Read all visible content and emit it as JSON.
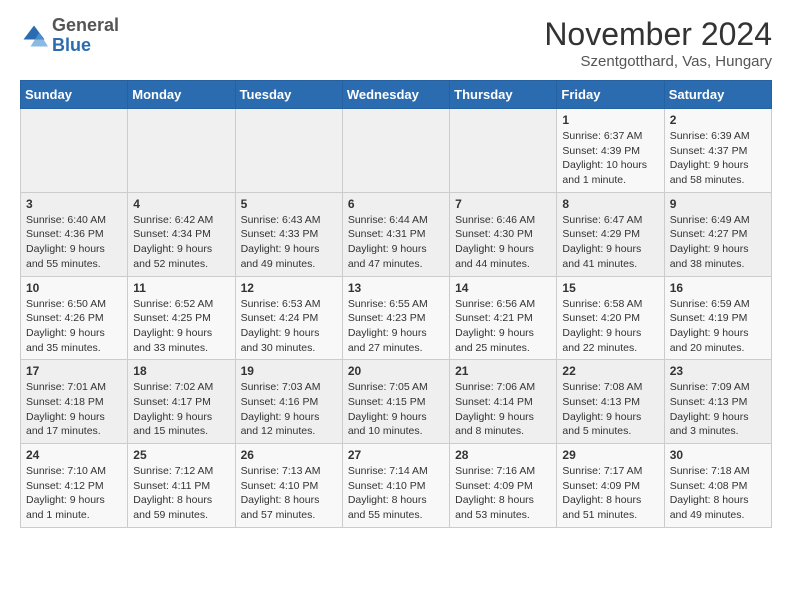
{
  "header": {
    "logo_general": "General",
    "logo_blue": "Blue",
    "title": "November 2024",
    "subtitle": "Szentgotthard, Vas, Hungary"
  },
  "days_of_week": [
    "Sunday",
    "Monday",
    "Tuesday",
    "Wednesday",
    "Thursday",
    "Friday",
    "Saturday"
  ],
  "weeks": [
    [
      {
        "day": "",
        "info": ""
      },
      {
        "day": "",
        "info": ""
      },
      {
        "day": "",
        "info": ""
      },
      {
        "day": "",
        "info": ""
      },
      {
        "day": "",
        "info": ""
      },
      {
        "day": "1",
        "info": "Sunrise: 6:37 AM\nSunset: 4:39 PM\nDaylight: 10 hours and 1 minute."
      },
      {
        "day": "2",
        "info": "Sunrise: 6:39 AM\nSunset: 4:37 PM\nDaylight: 9 hours and 58 minutes."
      }
    ],
    [
      {
        "day": "3",
        "info": "Sunrise: 6:40 AM\nSunset: 4:36 PM\nDaylight: 9 hours and 55 minutes."
      },
      {
        "day": "4",
        "info": "Sunrise: 6:42 AM\nSunset: 4:34 PM\nDaylight: 9 hours and 52 minutes."
      },
      {
        "day": "5",
        "info": "Sunrise: 6:43 AM\nSunset: 4:33 PM\nDaylight: 9 hours and 49 minutes."
      },
      {
        "day": "6",
        "info": "Sunrise: 6:44 AM\nSunset: 4:31 PM\nDaylight: 9 hours and 47 minutes."
      },
      {
        "day": "7",
        "info": "Sunrise: 6:46 AM\nSunset: 4:30 PM\nDaylight: 9 hours and 44 minutes."
      },
      {
        "day": "8",
        "info": "Sunrise: 6:47 AM\nSunset: 4:29 PM\nDaylight: 9 hours and 41 minutes."
      },
      {
        "day": "9",
        "info": "Sunrise: 6:49 AM\nSunset: 4:27 PM\nDaylight: 9 hours and 38 minutes."
      }
    ],
    [
      {
        "day": "10",
        "info": "Sunrise: 6:50 AM\nSunset: 4:26 PM\nDaylight: 9 hours and 35 minutes."
      },
      {
        "day": "11",
        "info": "Sunrise: 6:52 AM\nSunset: 4:25 PM\nDaylight: 9 hours and 33 minutes."
      },
      {
        "day": "12",
        "info": "Sunrise: 6:53 AM\nSunset: 4:24 PM\nDaylight: 9 hours and 30 minutes."
      },
      {
        "day": "13",
        "info": "Sunrise: 6:55 AM\nSunset: 4:23 PM\nDaylight: 9 hours and 27 minutes."
      },
      {
        "day": "14",
        "info": "Sunrise: 6:56 AM\nSunset: 4:21 PM\nDaylight: 9 hours and 25 minutes."
      },
      {
        "day": "15",
        "info": "Sunrise: 6:58 AM\nSunset: 4:20 PM\nDaylight: 9 hours and 22 minutes."
      },
      {
        "day": "16",
        "info": "Sunrise: 6:59 AM\nSunset: 4:19 PM\nDaylight: 9 hours and 20 minutes."
      }
    ],
    [
      {
        "day": "17",
        "info": "Sunrise: 7:01 AM\nSunset: 4:18 PM\nDaylight: 9 hours and 17 minutes."
      },
      {
        "day": "18",
        "info": "Sunrise: 7:02 AM\nSunset: 4:17 PM\nDaylight: 9 hours and 15 minutes."
      },
      {
        "day": "19",
        "info": "Sunrise: 7:03 AM\nSunset: 4:16 PM\nDaylight: 9 hours and 12 minutes."
      },
      {
        "day": "20",
        "info": "Sunrise: 7:05 AM\nSunset: 4:15 PM\nDaylight: 9 hours and 10 minutes."
      },
      {
        "day": "21",
        "info": "Sunrise: 7:06 AM\nSunset: 4:14 PM\nDaylight: 9 hours and 8 minutes."
      },
      {
        "day": "22",
        "info": "Sunrise: 7:08 AM\nSunset: 4:13 PM\nDaylight: 9 hours and 5 minutes."
      },
      {
        "day": "23",
        "info": "Sunrise: 7:09 AM\nSunset: 4:13 PM\nDaylight: 9 hours and 3 minutes."
      }
    ],
    [
      {
        "day": "24",
        "info": "Sunrise: 7:10 AM\nSunset: 4:12 PM\nDaylight: 9 hours and 1 minute."
      },
      {
        "day": "25",
        "info": "Sunrise: 7:12 AM\nSunset: 4:11 PM\nDaylight: 8 hours and 59 minutes."
      },
      {
        "day": "26",
        "info": "Sunrise: 7:13 AM\nSunset: 4:10 PM\nDaylight: 8 hours and 57 minutes."
      },
      {
        "day": "27",
        "info": "Sunrise: 7:14 AM\nSunset: 4:10 PM\nDaylight: 8 hours and 55 minutes."
      },
      {
        "day": "28",
        "info": "Sunrise: 7:16 AM\nSunset: 4:09 PM\nDaylight: 8 hours and 53 minutes."
      },
      {
        "day": "29",
        "info": "Sunrise: 7:17 AM\nSunset: 4:09 PM\nDaylight: 8 hours and 51 minutes."
      },
      {
        "day": "30",
        "info": "Sunrise: 7:18 AM\nSunset: 4:08 PM\nDaylight: 8 hours and 49 minutes."
      }
    ]
  ]
}
